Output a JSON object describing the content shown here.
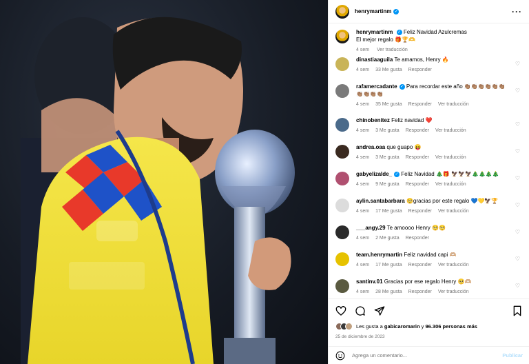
{
  "post": {
    "author": "henrymartinm",
    "more_icon": "more-horizontal-icon"
  },
  "caption": {
    "author": "henrymartinm",
    "line1": "Feliz Navidad Azulcremas",
    "line2": "El mejor regalo 🎁🏆🫶",
    "age": "4 sem",
    "see_translation": "Ver traducción"
  },
  "comments": [
    {
      "user": "dinastiaaguila",
      "text": "Te amamos, Henry 🔥",
      "age": "4 sem",
      "likes": "33 Me gusta",
      "reply": "Responder",
      "translate": "",
      "avatar_color": "#c9b458"
    },
    {
      "user": "rafamercadante",
      "verified": true,
      "text": "Para recordar este año 👏🏽👏🏽👏🏽👏🏽👏🏽👏🏽👏🏽👏🏽👏🏽👏🏽",
      "age": "4 sem",
      "likes": "35 Me gusta",
      "reply": "Responder",
      "translate": "Ver traducción",
      "avatar_color": "#7a7a7a"
    },
    {
      "user": "chinobenitez",
      "text": "Feliz navidad ❤️",
      "age": "4 sem",
      "likes": "3 Me gusta",
      "reply": "Responder",
      "translate": "Ver traducción",
      "avatar_color": "#4a6a8a"
    },
    {
      "user": "andrea.oaa",
      "text": "que guapo 😝",
      "age": "4 sem",
      "likes": "3 Me gusta",
      "reply": "Responder",
      "translate": "Ver traducción",
      "avatar_color": "#3a2a20"
    },
    {
      "user": "gabyelizalde_",
      "verified": true,
      "text": "Feliz Navidad 🎄🎁 🦅🦅🦅🎄🎄🎄🎄",
      "age": "4 sem",
      "likes": "9 Me gusta",
      "reply": "Responder",
      "translate": "Ver traducción",
      "avatar_color": "#b05070"
    },
    {
      "user": "aylin.santabarbara",
      "text": "🥺gracias por este regalo 💙💛🦅🏆",
      "age": "4 sem",
      "likes": "17 Me gusta",
      "reply": "Responder",
      "translate": "Ver traducción",
      "avatar_color": "#dcdcdc"
    },
    {
      "user": "___angy.29",
      "text": "Te amoooo Henry 🥺🥺",
      "age": "4 sem",
      "likes": "2 Me gusta",
      "reply": "Responder",
      "translate": "",
      "avatar_color": "#2a2a2a"
    },
    {
      "user": "team.henrymartin",
      "text": "Feliz navidad capi 🫶🏼",
      "age": "4 sem",
      "likes": "17 Me gusta",
      "reply": "Responder",
      "translate": "Ver traducción",
      "avatar_color": "#e6c200"
    },
    {
      "user": "santinv.01",
      "text": "Gracias por ese regalo Henry 🥺🫶🏼",
      "age": "4 sem",
      "likes": "28 Me gusta",
      "reply": "Responder",
      "translate": "Ver traducción",
      "avatar_color": "#5a5a40"
    }
  ],
  "actions": {
    "like_icon": "heart-icon",
    "comment_icon": "comment-icon",
    "share_icon": "send-icon",
    "save_icon": "bookmark-icon"
  },
  "likes": {
    "prefix": "Les gusta a ",
    "user": "gabicaromarin",
    "middle": " y ",
    "count": "96.306 personas más"
  },
  "date": "25 de diciembre de 2023",
  "add_comment": {
    "placeholder": "Agrega un comentario...",
    "publish": "Publicar"
  },
  "colors": {
    "verified": "#0095f6",
    "meta_text": "#737373",
    "publish_disabled": "#b2dffc"
  }
}
